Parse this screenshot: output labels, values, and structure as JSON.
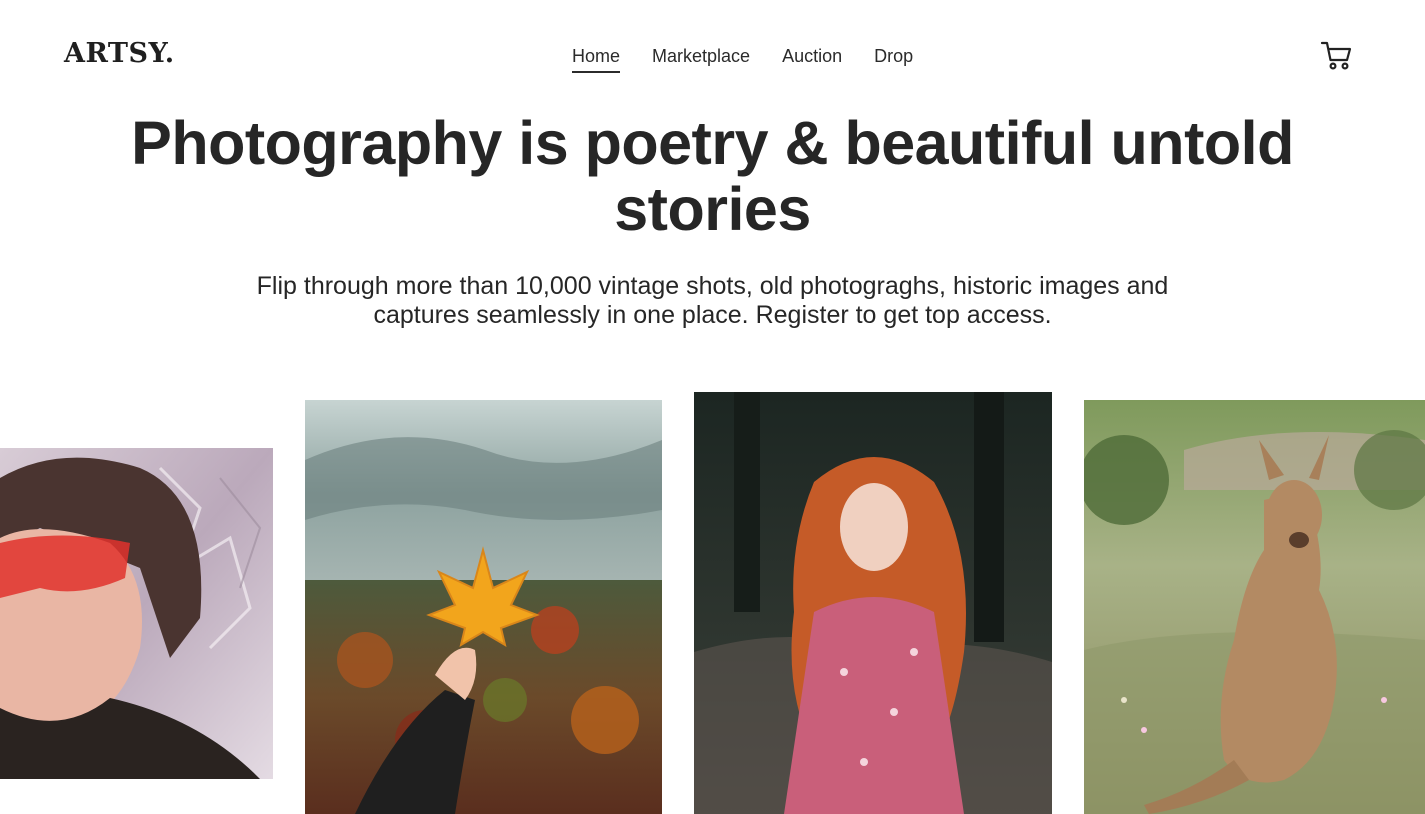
{
  "header": {
    "logo": "ARTSY.",
    "nav": [
      {
        "label": "Home",
        "active": true
      },
      {
        "label": "Marketplace",
        "active": false
      },
      {
        "label": "Auction",
        "active": false
      },
      {
        "label": "Drop",
        "active": false
      }
    ],
    "cart_icon": "shopping-cart-icon"
  },
  "hero": {
    "title": "Photography is poetry & beautiful untold stories",
    "subtitle": "Flip through more than 10,000 vintage shots, old photograghs, historic images and captures seamlessly in one place. Register to get top access."
  },
  "gallery": {
    "photos": [
      {
        "subject": "portrait-red-glasses"
      },
      {
        "subject": "autumn-leaf-landscape"
      },
      {
        "subject": "red-haired-woman-forest"
      },
      {
        "subject": "kangaroo-field"
      }
    ]
  },
  "colors": {
    "text": "#262626",
    "background": "#ffffff"
  }
}
